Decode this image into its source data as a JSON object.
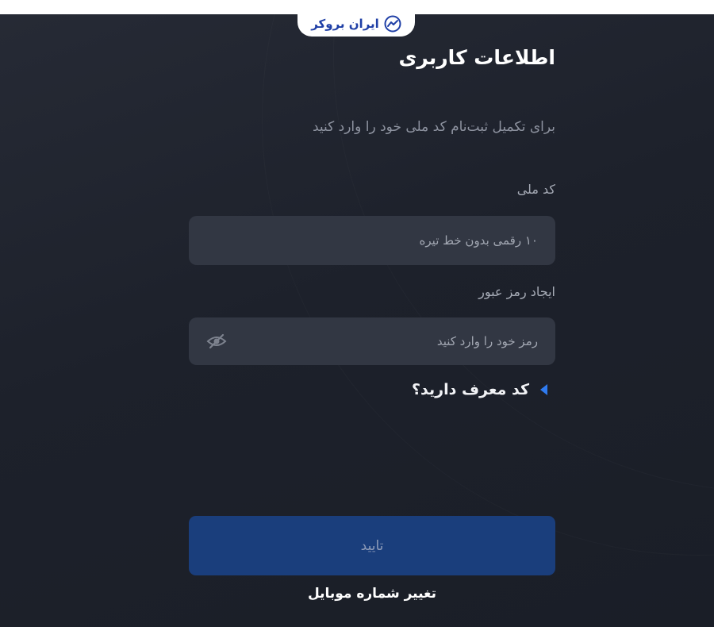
{
  "brand": {
    "logo_text": "ایران بروکر",
    "logo_icon": "chart-trend-icon",
    "accent_color": "#1f3fa6"
  },
  "page": {
    "title": "اطلاعات کاربری",
    "subtitle": "برای تکمیل ثبت‌نام کد ملی خود را وارد کنید"
  },
  "form": {
    "national_code": {
      "label": "کد ملی",
      "placeholder": "۱۰ رقمی بدون خط تیره",
      "value": ""
    },
    "password": {
      "label": "ایجاد رمز عبور",
      "placeholder": "رمز خود را وارد کنید",
      "value": "",
      "toggle_icon": "eye-off-icon"
    },
    "referral": {
      "label": "کد معرف دارید؟",
      "icon": "caret-left-icon",
      "icon_color": "#2f7bf0"
    },
    "submit_label": "تایید",
    "submit_color": "#1a3e7c",
    "change_mobile_label": "تغییر شماره موبایل"
  }
}
